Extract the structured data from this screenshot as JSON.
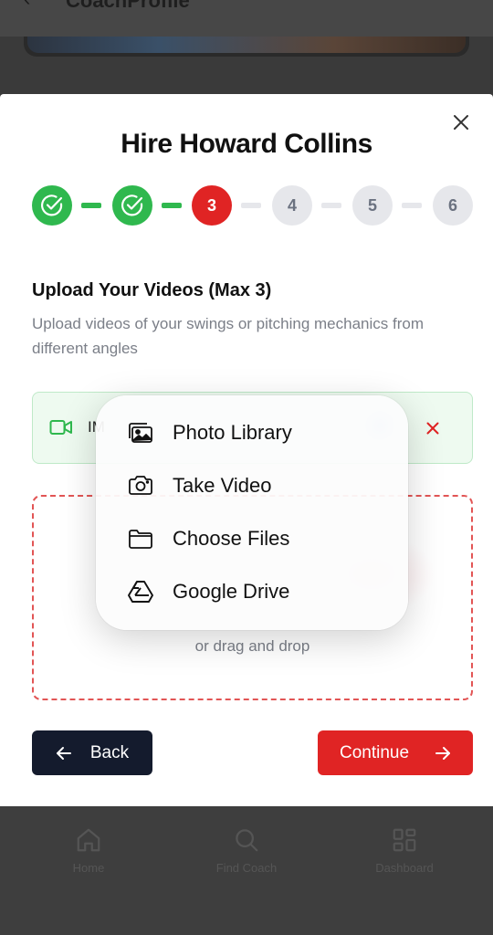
{
  "background": {
    "header_title": "CoachProfile",
    "nav": [
      {
        "label": "Home",
        "icon": "home-icon"
      },
      {
        "label": "Find Coach",
        "icon": "search-icon"
      },
      {
        "label": "Dashboard",
        "icon": "dashboard-icon"
      }
    ]
  },
  "modal": {
    "title": "Hire Howard Collins",
    "close_icon": "close-icon",
    "steps": [
      {
        "label": "",
        "state": "done"
      },
      {
        "label": "",
        "state": "done"
      },
      {
        "label": "3",
        "state": "current"
      },
      {
        "label": "4",
        "state": "todo"
      },
      {
        "label": "5",
        "state": "todo"
      },
      {
        "label": "6",
        "state": "todo"
      }
    ],
    "section_title": "Upload Your Videos (Max 3)",
    "section_desc": "Upload videos of your swings or pitching mechanics from different angles",
    "file_name": "IM",
    "dropzone_hint": "or drag and drop",
    "back_label": "Back",
    "continue_label": "Continue"
  },
  "popup": {
    "items": [
      {
        "label": "Photo Library",
        "icon": "photo-library-icon"
      },
      {
        "label": "Take Video",
        "icon": "camera-icon"
      },
      {
        "label": "Choose Files",
        "icon": "folder-icon"
      },
      {
        "label": "Google Drive",
        "icon": "google-drive-icon"
      }
    ]
  },
  "colors": {
    "accent_red": "#e02424",
    "success_green": "#2fb84e",
    "dark_button": "#141b2d"
  }
}
